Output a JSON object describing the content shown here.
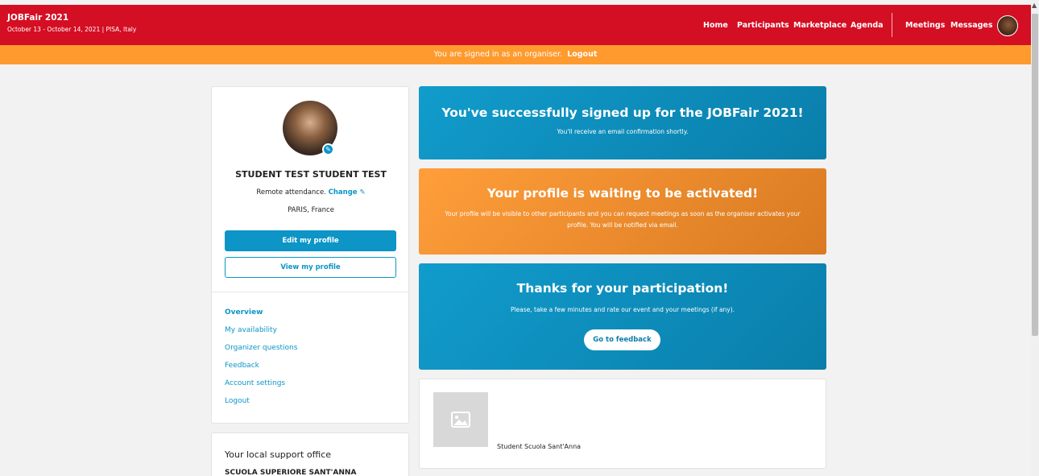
{
  "header": {
    "event_title": "JOBFair 2021",
    "event_subtitle": "October 13 - October 14, 2021 | PISA, Italy",
    "nav": [
      "Home",
      "Participants",
      "Marketplace",
      "Agenda",
      "Meetings",
      "Messages"
    ],
    "brand_color": "#d40e23"
  },
  "banner": {
    "text": "You are signed in as an organiser.",
    "logout": "Logout",
    "color": "#ff9a2e"
  },
  "profile": {
    "name": "STUDENT TEST STUDENT TEST",
    "attendance": "Remote attendance.",
    "change": "Change",
    "location": "PARIS, France",
    "edit_button": "Edit my profile",
    "view_button": "View my profile"
  },
  "menu": [
    "Overview",
    "My availability",
    "Organizer questions",
    "Feedback",
    "Account settings",
    "Logout"
  ],
  "support": {
    "title": "Your local support office",
    "org": "SCUOLA SUPERIORE SANT'ANNA"
  },
  "signup_box": {
    "title": "You've successfully signed up for the JOBFair 2021!",
    "text": "You'll receive an email confirmation shortly."
  },
  "waiting_box": {
    "title": "Your profile is waiting to be activated!",
    "text": "Your profile will be visible to other participants and you can request meetings as soon as the organiser activates your profile. You will be notified via email."
  },
  "thanks_box": {
    "title": "Thanks for your participation!",
    "text": "Please, take a few minutes and rate our event and your meetings (if any).",
    "button": "Go to feedback"
  },
  "organization": {
    "name": "Student Scuola Sant'Anna"
  },
  "accent_color": "#0c95c6"
}
